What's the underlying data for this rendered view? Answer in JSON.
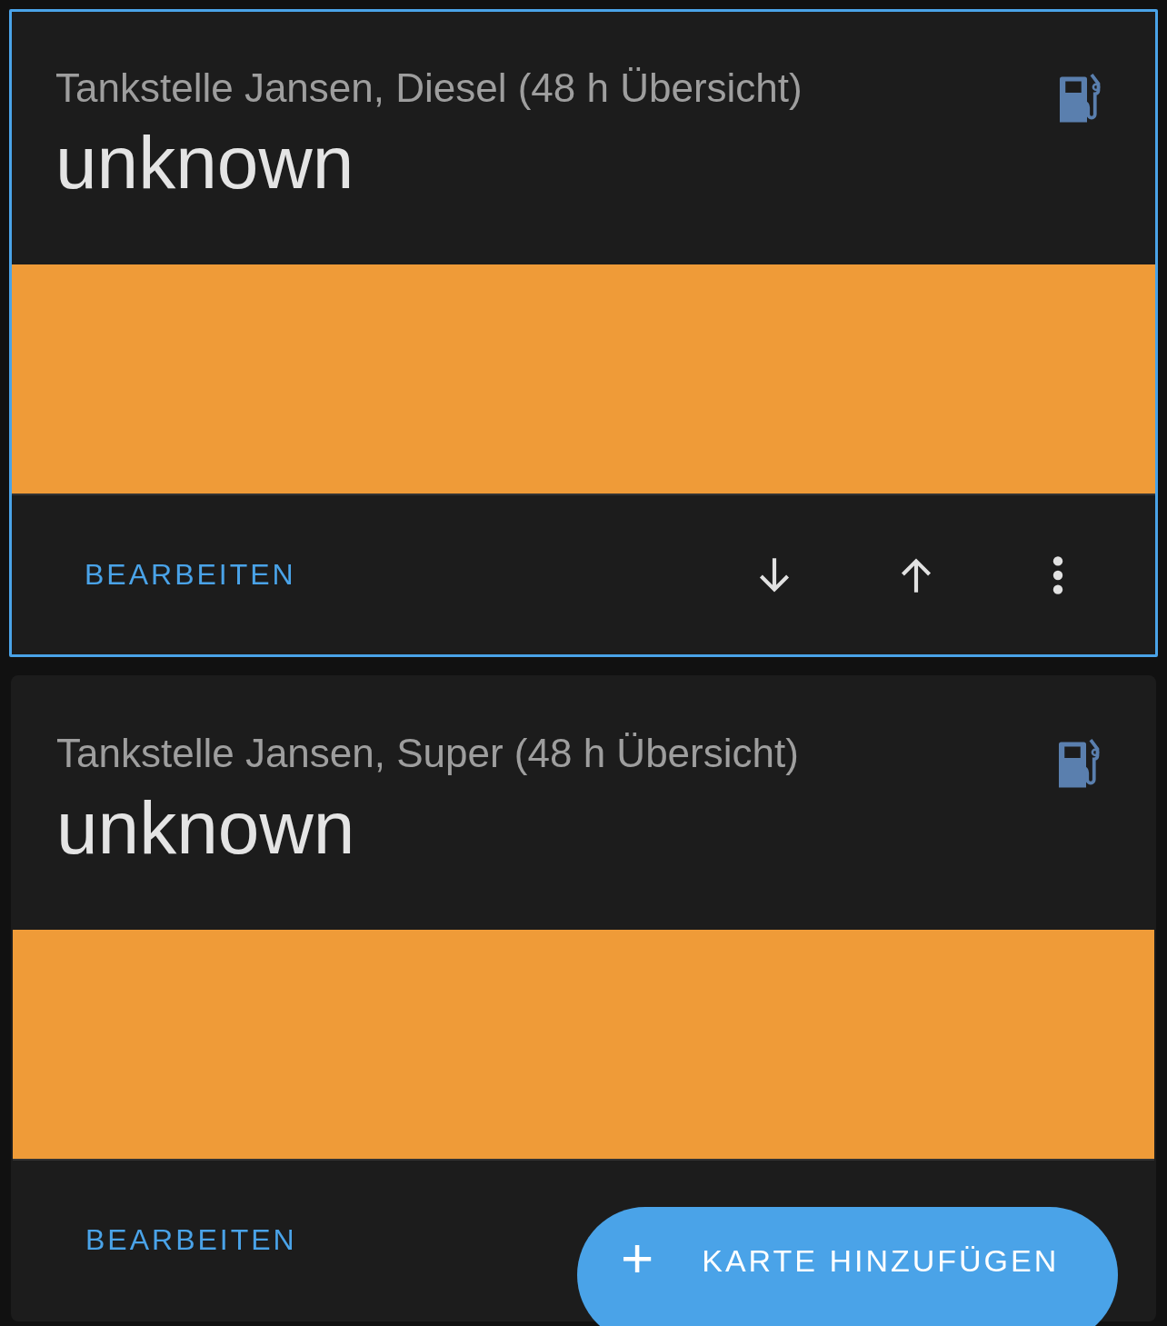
{
  "cards": [
    {
      "title": "Tankstelle Jansen, Diesel (48 h Übersicht)",
      "state": "unknown",
      "selected": true,
      "edit_label": "BEARBEITEN",
      "actions": [
        {
          "kind": "move-down"
        },
        {
          "kind": "move-up"
        },
        {
          "kind": "more"
        }
      ]
    },
    {
      "title": "Tankstelle Jansen, Super (48 h Übersicht)",
      "state": "unknown",
      "selected": false,
      "edit_label": "BEARBEITEN"
    }
  ],
  "fab": {
    "icon": "+",
    "label": "KARTE HINZUFÜGEN"
  }
}
